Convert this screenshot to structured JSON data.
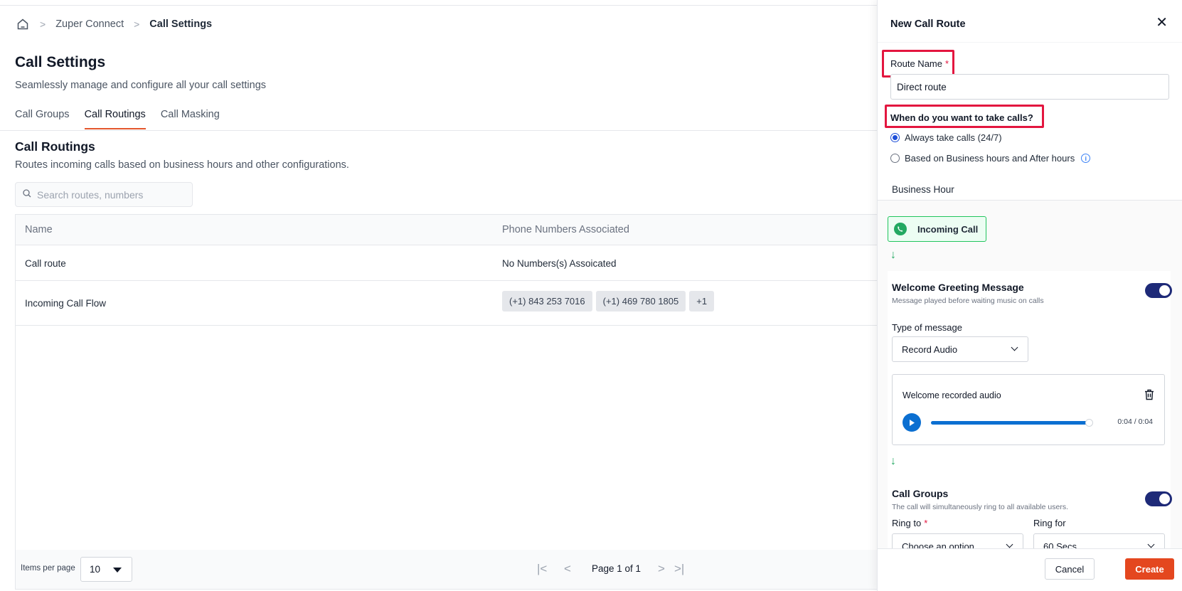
{
  "breadcrumb": {
    "home_icon": "home-icon",
    "items": [
      "Zuper Connect",
      "Call Settings"
    ]
  },
  "page": {
    "title": "Call Settings",
    "subtitle": "Seamlessly manage and configure all your call settings",
    "tabs": [
      {
        "label": "Call Groups",
        "active": false
      },
      {
        "label": "Call Routings",
        "active": true
      },
      {
        "label": "Call Masking",
        "active": false
      }
    ]
  },
  "section": {
    "title": "Call Routings",
    "subtitle": "Routes incoming calls based on business hours and other configurations."
  },
  "search": {
    "placeholder": "Search routes, numbers",
    "value": ""
  },
  "table": {
    "columns": [
      "Name",
      "Phone Numbers Associated"
    ],
    "rows": [
      {
        "name": "Call route",
        "numbers_text": "No Numbers(s) Assoicated",
        "numbers": []
      },
      {
        "name": "Incoming Call Flow",
        "numbers_text": "",
        "numbers": [
          "(+1) 843 253 7016",
          "(+1) 469 780 1805",
          "+1"
        ]
      }
    ]
  },
  "pagination": {
    "items_per_page_label": "Items per page",
    "items_per_page": "10",
    "page_text": "Page 1 of 1"
  },
  "drawer": {
    "title": "New Call Route",
    "route_name_label": "Route Name",
    "required_mark": "*",
    "route_name_value": "Direct route",
    "question": "When do you want to take calls?",
    "options": [
      {
        "label": "Always take calls (24/7)",
        "selected": true
      },
      {
        "label": "Based on Business hours and After hours",
        "selected": false
      }
    ],
    "tab": "Business Hour",
    "incoming_call_label": "Incoming Call",
    "greeting": {
      "title": "Welcome Greeting Message",
      "subtitle": "Message played before waiting music on calls",
      "enabled": true,
      "type_label": "Type of message",
      "type_value": "Record Audio",
      "audio_name": "Welcome recorded audio",
      "audio_time": "0:04 / 0:04",
      "progress_fraction": 1.0
    },
    "call_groups": {
      "title": "Call Groups",
      "subtitle": "The call will simultaneously ring to all available users.",
      "enabled": true,
      "ring_to_label": "Ring to",
      "ring_to_value": "Choose an option",
      "ring_for_label": "Ring for",
      "ring_for_value": "60 Secs"
    },
    "cancel_label": "Cancel",
    "create_label": "Create"
  },
  "colors": {
    "accent": "#e4572e",
    "highlight": "#e3163f",
    "toggle": "#1e2a78",
    "primary_blue": "#0b6fd1",
    "success_green": "#22a861"
  }
}
